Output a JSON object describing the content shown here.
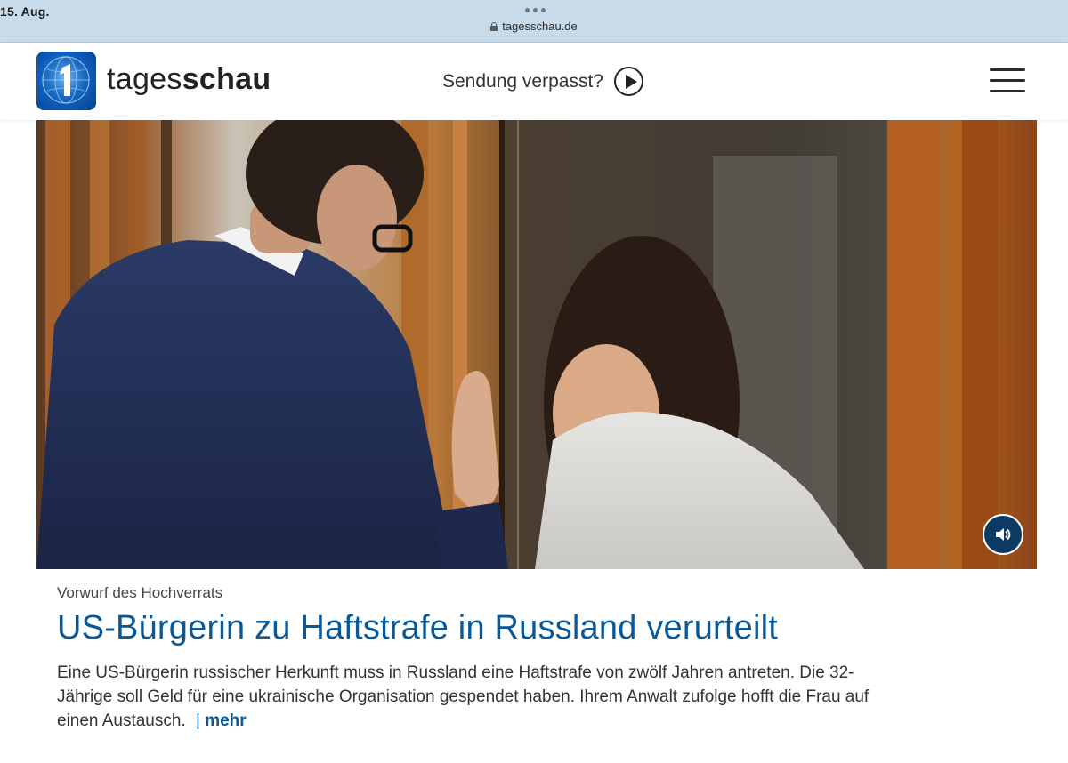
{
  "statusbar": {
    "date": "15. Aug.",
    "url": "tagesschau.de"
  },
  "header": {
    "logo_text_regular": "tages",
    "logo_text_bold": "schau",
    "missed_label": "Sendung verpasst?"
  },
  "article": {
    "kicker": "Vorwurf des Hochverrats",
    "headline": "US-Bürgerin zu Haftstrafe in Russland verurteilt",
    "teaser": "Eine US-Bürgerin russischer Herkunft muss in Russland eine Haftstrafe von zwölf Jahren antreten. Die 32-Jährige soll Geld für eine ukrainische Organisation gespendet haben. Ihrem Anwalt zufolge hofft die Frau auf einen Austausch.",
    "more_bar": "|",
    "more_label": "mehr"
  },
  "colors": {
    "status_bar": "#c9dbe9",
    "link_blue": "#0a5996",
    "logo_blue": "#0d5db8",
    "sound_button": "#0c3a63"
  },
  "icons": {
    "lock": "lock-icon",
    "play": "play-circle-icon",
    "menu": "hamburger-menu-icon",
    "sound": "speaker-icon"
  }
}
